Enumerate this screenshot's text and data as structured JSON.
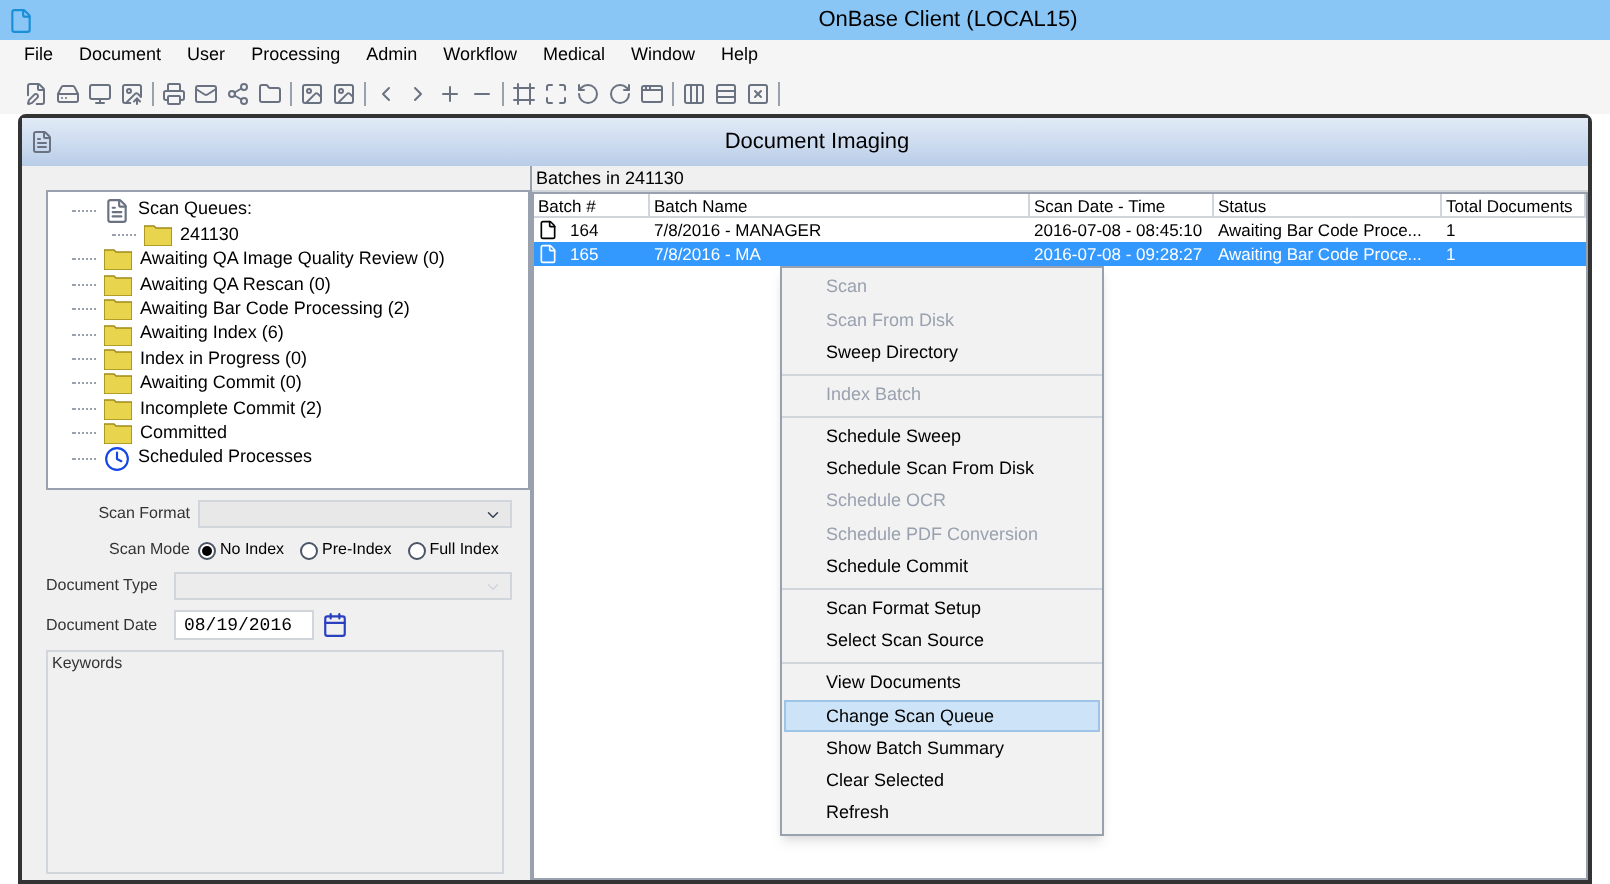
{
  "window": {
    "title": "OnBase Client (LOCAL15)"
  },
  "menu_bar": [
    "File",
    "Document",
    "User",
    "Processing",
    "Admin",
    "Workflow",
    "Medical",
    "Window",
    "Help"
  ],
  "document_window": {
    "title": "Document Imaging"
  },
  "tree": [
    {
      "label": "Scan Queues:",
      "kind": "queues",
      "children": [
        {
          "label": "241130",
          "kind": "folder"
        }
      ]
    },
    {
      "label": "Awaiting QA Image Quality Review (0)",
      "kind": "folder"
    },
    {
      "label": "Awaiting QA Rescan (0)",
      "kind": "folder"
    },
    {
      "label": "Awaiting Bar Code Processing (2)",
      "kind": "folder"
    },
    {
      "label": "Awaiting Index (6)",
      "kind": "folder"
    },
    {
      "label": "Index in Progress (0)",
      "kind": "folder"
    },
    {
      "label": "Awaiting Commit (0)",
      "kind": "folder"
    },
    {
      "label": "Incomplete Commit (2)",
      "kind": "folder"
    },
    {
      "label": "Committed",
      "kind": "folder"
    },
    {
      "label": "Scheduled Processes",
      "kind": "schedule"
    }
  ],
  "form": {
    "scan_format": {
      "label": "Scan Format"
    },
    "scan_mode": {
      "label": "Scan Mode",
      "options": [
        {
          "label": "No Index",
          "selected": true
        },
        {
          "label": "Pre-Index",
          "selected": false
        },
        {
          "label": "Full Index",
          "selected": false
        }
      ]
    },
    "document_type": {
      "label": "Document Type",
      "disabled": true
    },
    "document_date": {
      "label": "Document Date",
      "value": "08/19/2016"
    },
    "keywords": {
      "label": "Keywords"
    }
  },
  "batches": {
    "title": "Batches in 241130",
    "columns": [
      "Batch #",
      "Batch Name",
      "Scan Date - Time",
      "Status",
      "Total Documents"
    ],
    "rows": [
      {
        "cells": [
          "164",
          "7/8/2016 - MANAGER",
          "2016-07-08 - 08:45:10",
          "Awaiting Bar Code Proce...",
          "1"
        ],
        "selected": false
      },
      {
        "cells": [
          "165",
          "7/8/2016 - MA",
          "2016-07-08 - 09:28:27",
          "Awaiting Bar Code Proce...",
          "1"
        ],
        "selected": true
      }
    ]
  },
  "context_menu": [
    [
      {
        "label": "Scan",
        "disabled": true,
        "selected": false
      },
      {
        "label": "Scan From Disk",
        "disabled": true,
        "selected": false
      },
      {
        "label": "Sweep Directory",
        "disabled": false,
        "selected": false
      }
    ],
    [
      {
        "label": "Index Batch",
        "disabled": true,
        "selected": false
      }
    ],
    [
      {
        "label": "Schedule Sweep",
        "disabled": false,
        "selected": false
      },
      {
        "label": "Schedule Scan From Disk",
        "disabled": false,
        "selected": false
      },
      {
        "label": "Schedule OCR",
        "disabled": true,
        "selected": false
      },
      {
        "label": "Schedule PDF Conversion",
        "disabled": true,
        "selected": false
      },
      {
        "label": "Schedule Commit",
        "disabled": false,
        "selected": false
      }
    ],
    [
      {
        "label": "Scan Format Setup",
        "disabled": false,
        "selected": false
      },
      {
        "label": "Select Scan Source",
        "disabled": false,
        "selected": false
      }
    ],
    [
      {
        "label": "View Documents",
        "disabled": false,
        "selected": false
      },
      {
        "label": "Change Scan Queue",
        "disabled": false,
        "selected": true
      },
      {
        "label": "Show Batch Summary",
        "disabled": false,
        "selected": false
      },
      {
        "label": "Clear Selected",
        "disabled": false,
        "selected": false
      },
      {
        "label": "Refresh",
        "disabled": false,
        "selected": false
      }
    ]
  ]
}
